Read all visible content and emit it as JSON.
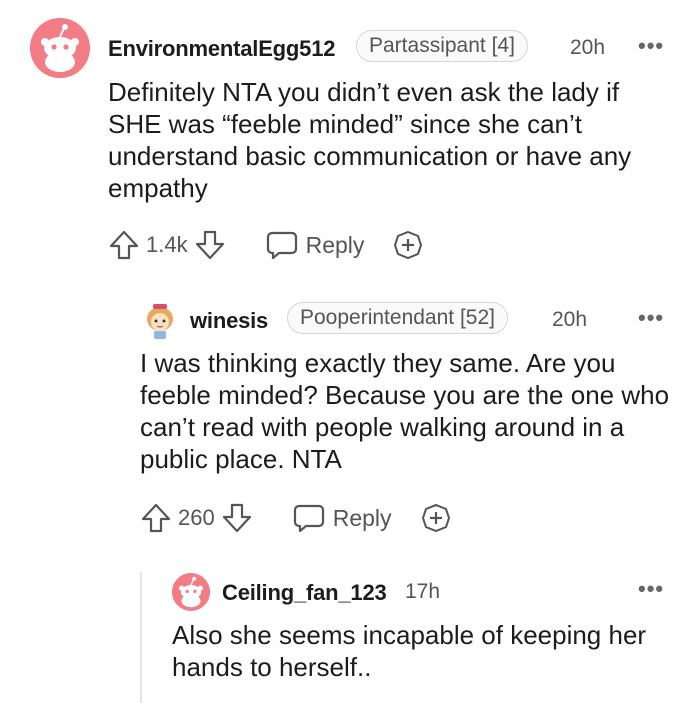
{
  "comments": [
    {
      "username": "EnvironmentalEgg512",
      "flair": "Partassipant [4]",
      "time": "20h",
      "more": "•••",
      "body": "Definitely NTA you didn’t even ask the lady if SHE was “feeble minded” since she can’t understand basic communication or have any empathy",
      "votes": "1.4k",
      "reply_label": "Reply",
      "avatar_color": "#f47c84"
    },
    {
      "username": "winesis",
      "flair": "Pooperintendant [52]",
      "time": "20h",
      "more": "•••",
      "body": "I was thinking exactly they same. Are you feeble minded? Because you are the one who can’t read with people walking around in a public place. NTA",
      "votes": "260",
      "reply_label": "Reply",
      "avatar_color": "#f6c453"
    },
    {
      "username": "Ceiling_fan_123",
      "time": "17h",
      "more": "•••",
      "body": "Also she seems incapable of keeping her hands to herself..",
      "avatar_color": "#f47c84"
    }
  ]
}
